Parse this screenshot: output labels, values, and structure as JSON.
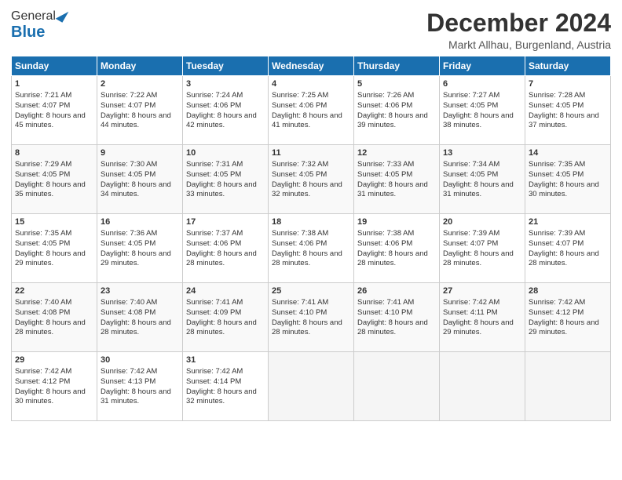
{
  "logo": {
    "general": "General",
    "blue": "Blue"
  },
  "title": "December 2024",
  "location": "Markt Allhau, Burgenland, Austria",
  "days_of_week": [
    "Sunday",
    "Monday",
    "Tuesday",
    "Wednesday",
    "Thursday",
    "Friday",
    "Saturday"
  ],
  "weeks": [
    [
      {
        "day": 1,
        "sunrise": "7:21 AM",
        "sunset": "4:07 PM",
        "daylight": "8 hours and 45 minutes."
      },
      {
        "day": 2,
        "sunrise": "7:22 AM",
        "sunset": "4:07 PM",
        "daylight": "8 hours and 44 minutes."
      },
      {
        "day": 3,
        "sunrise": "7:24 AM",
        "sunset": "4:06 PM",
        "daylight": "8 hours and 42 minutes."
      },
      {
        "day": 4,
        "sunrise": "7:25 AM",
        "sunset": "4:06 PM",
        "daylight": "8 hours and 41 minutes."
      },
      {
        "day": 5,
        "sunrise": "7:26 AM",
        "sunset": "4:06 PM",
        "daylight": "8 hours and 39 minutes."
      },
      {
        "day": 6,
        "sunrise": "7:27 AM",
        "sunset": "4:05 PM",
        "daylight": "8 hours and 38 minutes."
      },
      {
        "day": 7,
        "sunrise": "7:28 AM",
        "sunset": "4:05 PM",
        "daylight": "8 hours and 37 minutes."
      }
    ],
    [
      {
        "day": 8,
        "sunrise": "7:29 AM",
        "sunset": "4:05 PM",
        "daylight": "8 hours and 35 minutes."
      },
      {
        "day": 9,
        "sunrise": "7:30 AM",
        "sunset": "4:05 PM",
        "daylight": "8 hours and 34 minutes."
      },
      {
        "day": 10,
        "sunrise": "7:31 AM",
        "sunset": "4:05 PM",
        "daylight": "8 hours and 33 minutes."
      },
      {
        "day": 11,
        "sunrise": "7:32 AM",
        "sunset": "4:05 PM",
        "daylight": "8 hours and 32 minutes."
      },
      {
        "day": 12,
        "sunrise": "7:33 AM",
        "sunset": "4:05 PM",
        "daylight": "8 hours and 31 minutes."
      },
      {
        "day": 13,
        "sunrise": "7:34 AM",
        "sunset": "4:05 PM",
        "daylight": "8 hours and 31 minutes."
      },
      {
        "day": 14,
        "sunrise": "7:35 AM",
        "sunset": "4:05 PM",
        "daylight": "8 hours and 30 minutes."
      }
    ],
    [
      {
        "day": 15,
        "sunrise": "7:35 AM",
        "sunset": "4:05 PM",
        "daylight": "8 hours and 29 minutes."
      },
      {
        "day": 16,
        "sunrise": "7:36 AM",
        "sunset": "4:05 PM",
        "daylight": "8 hours and 29 minutes."
      },
      {
        "day": 17,
        "sunrise": "7:37 AM",
        "sunset": "4:06 PM",
        "daylight": "8 hours and 28 minutes."
      },
      {
        "day": 18,
        "sunrise": "7:38 AM",
        "sunset": "4:06 PM",
        "daylight": "8 hours and 28 minutes."
      },
      {
        "day": 19,
        "sunrise": "7:38 AM",
        "sunset": "4:06 PM",
        "daylight": "8 hours and 28 minutes."
      },
      {
        "day": 20,
        "sunrise": "7:39 AM",
        "sunset": "4:07 PM",
        "daylight": "8 hours and 28 minutes."
      },
      {
        "day": 21,
        "sunrise": "7:39 AM",
        "sunset": "4:07 PM",
        "daylight": "8 hours and 28 minutes."
      }
    ],
    [
      {
        "day": 22,
        "sunrise": "7:40 AM",
        "sunset": "4:08 PM",
        "daylight": "8 hours and 28 minutes."
      },
      {
        "day": 23,
        "sunrise": "7:40 AM",
        "sunset": "4:08 PM",
        "daylight": "8 hours and 28 minutes."
      },
      {
        "day": 24,
        "sunrise": "7:41 AM",
        "sunset": "4:09 PM",
        "daylight": "8 hours and 28 minutes."
      },
      {
        "day": 25,
        "sunrise": "7:41 AM",
        "sunset": "4:10 PM",
        "daylight": "8 hours and 28 minutes."
      },
      {
        "day": 26,
        "sunrise": "7:41 AM",
        "sunset": "4:10 PM",
        "daylight": "8 hours and 28 minutes."
      },
      {
        "day": 27,
        "sunrise": "7:42 AM",
        "sunset": "4:11 PM",
        "daylight": "8 hours and 29 minutes."
      },
      {
        "day": 28,
        "sunrise": "7:42 AM",
        "sunset": "4:12 PM",
        "daylight": "8 hours and 29 minutes."
      }
    ],
    [
      {
        "day": 29,
        "sunrise": "7:42 AM",
        "sunset": "4:12 PM",
        "daylight": "8 hours and 30 minutes."
      },
      {
        "day": 30,
        "sunrise": "7:42 AM",
        "sunset": "4:13 PM",
        "daylight": "8 hours and 31 minutes."
      },
      {
        "day": 31,
        "sunrise": "7:42 AM",
        "sunset": "4:14 PM",
        "daylight": "8 hours and 32 minutes."
      },
      null,
      null,
      null,
      null
    ]
  ]
}
